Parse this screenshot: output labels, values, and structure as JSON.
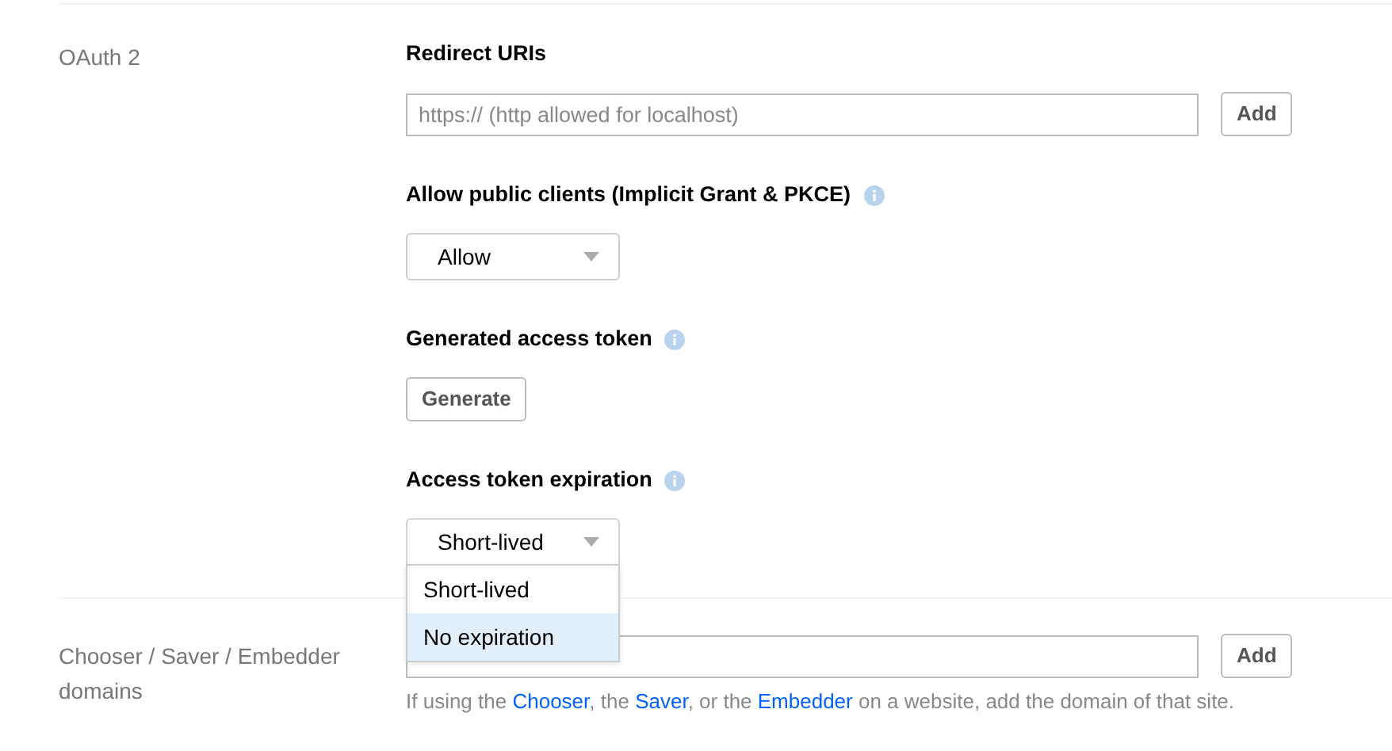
{
  "sections": [
    {
      "label": "OAuth 2",
      "fields": [
        {
          "kind": "url_list",
          "heading": "Redirect URIs",
          "info": false,
          "placeholder": "https:// (http allowed for localhost)",
          "button": "Add"
        },
        {
          "kind": "select",
          "heading": "Allow public clients (Implicit Grant & PKCE)",
          "info": true,
          "value": "Allow"
        },
        {
          "kind": "button",
          "heading": "Generated access token",
          "info": true,
          "button": "Generate"
        },
        {
          "kind": "select",
          "heading": "Access token expiration",
          "info": true,
          "value": "Short-lived",
          "expanded": true,
          "options": [
            {
              "label": "Short-lived",
              "highlighted": false
            },
            {
              "label": "No expiration",
              "highlighted": true
            }
          ]
        }
      ]
    },
    {
      "label": "Chooser / Saver / Embedder domains",
      "fields": [
        {
          "kind": "url_list",
          "button": "Add",
          "help": [
            {
              "kind": "text",
              "text": "If using the "
            },
            {
              "kind": "link",
              "text": "Chooser"
            },
            {
              "kind": "text",
              "text": ", the "
            },
            {
              "kind": "link",
              "text": "Saver"
            },
            {
              "kind": "text",
              "text": ", or the "
            },
            {
              "kind": "link",
              "text": "Embedder"
            },
            {
              "kind": "text",
              "text": " on a website, add the domain of that site."
            }
          ]
        }
      ]
    }
  ]
}
